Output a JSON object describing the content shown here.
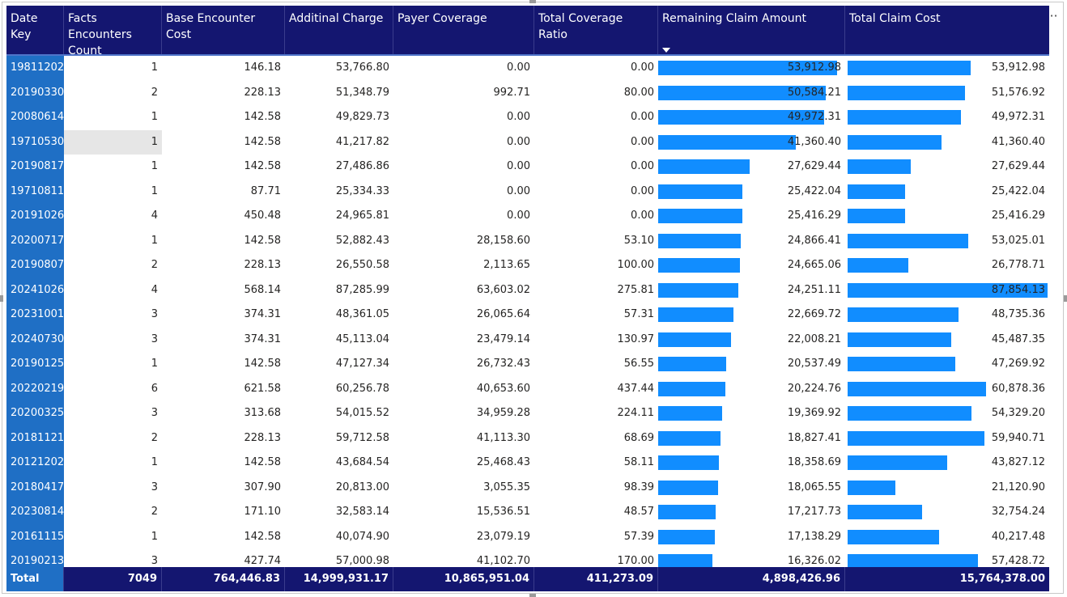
{
  "table": {
    "columns": [
      {
        "label": "Date Key"
      },
      {
        "label": "Facts Encounters Count"
      },
      {
        "label": "Base Encounter Cost"
      },
      {
        "label": "Additinal Charge"
      },
      {
        "label": "Payer Coverage"
      },
      {
        "label": "Total Coverage Ratio"
      },
      {
        "label": "Remaining Claim Amount"
      },
      {
        "label": "Total Claim Cost"
      }
    ],
    "rows": [
      {
        "date_key": "19811202",
        "count": "1",
        "base": "146.18",
        "additional": "53,766.80",
        "payer": "0.00",
        "ratio": "0.00",
        "remaining": "53,912.98",
        "remaining_val": 53912.98,
        "total": "53,912.98",
        "total_val": 53912.98
      },
      {
        "date_key": "20190330",
        "count": "2",
        "base": "228.13",
        "additional": "51,348.79",
        "payer": "992.71",
        "ratio": "80.00",
        "remaining": "50,584.21",
        "remaining_val": 50584.21,
        "total": "51,576.92",
        "total_val": 51576.92
      },
      {
        "date_key": "20080614",
        "count": "1",
        "base": "142.58",
        "additional": "49,829.73",
        "payer": "0.00",
        "ratio": "0.00",
        "remaining": "49,972.31",
        "remaining_val": 49972.31,
        "total": "49,972.31",
        "total_val": 49972.31
      },
      {
        "date_key": "19710530",
        "count": "1",
        "base": "142.58",
        "additional": "41,217.82",
        "payer": "0.00",
        "ratio": "0.00",
        "remaining": "41,360.40",
        "remaining_val": 41360.4,
        "total": "41,360.40",
        "total_val": 41360.4
      },
      {
        "date_key": "20190817",
        "count": "1",
        "base": "142.58",
        "additional": "27,486.86",
        "payer": "0.00",
        "ratio": "0.00",
        "remaining": "27,629.44",
        "remaining_val": 27629.44,
        "total": "27,629.44",
        "total_val": 27629.44
      },
      {
        "date_key": "19710811",
        "count": "1",
        "base": "87.71",
        "additional": "25,334.33",
        "payer": "0.00",
        "ratio": "0.00",
        "remaining": "25,422.04",
        "remaining_val": 25422.04,
        "total": "25,422.04",
        "total_val": 25422.04
      },
      {
        "date_key": "20191026",
        "count": "4",
        "base": "450.48",
        "additional": "24,965.81",
        "payer": "0.00",
        "ratio": "0.00",
        "remaining": "25,416.29",
        "remaining_val": 25416.29,
        "total": "25,416.29",
        "total_val": 25416.29
      },
      {
        "date_key": "20200717",
        "count": "1",
        "base": "142.58",
        "additional": "52,882.43",
        "payer": "28,158.60",
        "ratio": "53.10",
        "remaining": "24,866.41",
        "remaining_val": 24866.41,
        "total": "53,025.01",
        "total_val": 53025.01
      },
      {
        "date_key": "20190807",
        "count": "2",
        "base": "228.13",
        "additional": "26,550.58",
        "payer": "2,113.65",
        "ratio": "100.00",
        "remaining": "24,665.06",
        "remaining_val": 24665.06,
        "total": "26,778.71",
        "total_val": 26778.71
      },
      {
        "date_key": "20241026",
        "count": "4",
        "base": "568.14",
        "additional": "87,285.99",
        "payer": "63,603.02",
        "ratio": "275.81",
        "remaining": "24,251.11",
        "remaining_val": 24251.11,
        "total": "87,854.13",
        "total_val": 87854.13
      },
      {
        "date_key": "20231001",
        "count": "3",
        "base": "374.31",
        "additional": "48,361.05",
        "payer": "26,065.64",
        "ratio": "57.31",
        "remaining": "22,669.72",
        "remaining_val": 22669.72,
        "total": "48,735.36",
        "total_val": 48735.36
      },
      {
        "date_key": "20240730",
        "count": "3",
        "base": "374.31",
        "additional": "45,113.04",
        "payer": "23,479.14",
        "ratio": "130.97",
        "remaining": "22,008.21",
        "remaining_val": 22008.21,
        "total": "45,487.35",
        "total_val": 45487.35
      },
      {
        "date_key": "20190125",
        "count": "1",
        "base": "142.58",
        "additional": "47,127.34",
        "payer": "26,732.43",
        "ratio": "56.55",
        "remaining": "20,537.49",
        "remaining_val": 20537.49,
        "total": "47,269.92",
        "total_val": 47269.92
      },
      {
        "date_key": "20220219",
        "count": "6",
        "base": "621.58",
        "additional": "60,256.78",
        "payer": "40,653.60",
        "ratio": "437.44",
        "remaining": "20,224.76",
        "remaining_val": 20224.76,
        "total": "60,878.36",
        "total_val": 60878.36
      },
      {
        "date_key": "20200325",
        "count": "3",
        "base": "313.68",
        "additional": "54,015.52",
        "payer": "34,959.28",
        "ratio": "224.11",
        "remaining": "19,369.92",
        "remaining_val": 19369.92,
        "total": "54,329.20",
        "total_val": 54329.2
      },
      {
        "date_key": "20181121",
        "count": "2",
        "base": "228.13",
        "additional": "59,712.58",
        "payer": "41,113.30",
        "ratio": "68.69",
        "remaining": "18,827.41",
        "remaining_val": 18827.41,
        "total": "59,940.71",
        "total_val": 59940.71
      },
      {
        "date_key": "20121202",
        "count": "1",
        "base": "142.58",
        "additional": "43,684.54",
        "payer": "25,468.43",
        "ratio": "58.11",
        "remaining": "18,358.69",
        "remaining_val": 18358.69,
        "total": "43,827.12",
        "total_val": 43827.12
      },
      {
        "date_key": "20180417",
        "count": "3",
        "base": "307.90",
        "additional": "20,813.00",
        "payer": "3,055.35",
        "ratio": "98.39",
        "remaining": "18,065.55",
        "remaining_val": 18065.55,
        "total": "21,120.90",
        "total_val": 21120.9
      },
      {
        "date_key": "20230814",
        "count": "2",
        "base": "171.10",
        "additional": "32,583.14",
        "payer": "15,536.51",
        "ratio": "48.57",
        "remaining": "17,217.73",
        "remaining_val": 17217.73,
        "total": "32,754.24",
        "total_val": 32754.24
      },
      {
        "date_key": "20161115",
        "count": "1",
        "base": "142.58",
        "additional": "40,074.90",
        "payer": "23,079.19",
        "ratio": "57.39",
        "remaining": "17,138.29",
        "remaining_val": 17138.29,
        "total": "40,217.48",
        "total_val": 40217.48
      },
      {
        "date_key": "20190213",
        "count": "3",
        "base": "427.74",
        "additional": "57,000.98",
        "payer": "41,102.70",
        "ratio": "170.00",
        "remaining": "16,326.02",
        "remaining_val": 16326.02,
        "total": "57,428.72",
        "total_val": 57428.72
      }
    ],
    "totals": {
      "label": "Total",
      "count": "7049",
      "base": "764,446.83",
      "additional": "14,999,931.17",
      "payer": "10,865,951.04",
      "ratio": "411,273.09",
      "remaining": "4,898,426.96",
      "total": "15,764,378.00"
    },
    "selected_row_index": 3,
    "sort": {
      "column": "Remaining Claim Amount",
      "direction": "descending"
    },
    "bar_color": "#118dff",
    "header_color": "#141670",
    "row_header_color": "#1f6fc5"
  },
  "toolbar": {
    "icons": [
      "filter-icon",
      "focus-mode-icon",
      "more-options-icon"
    ],
    "more_glyph": "···"
  }
}
